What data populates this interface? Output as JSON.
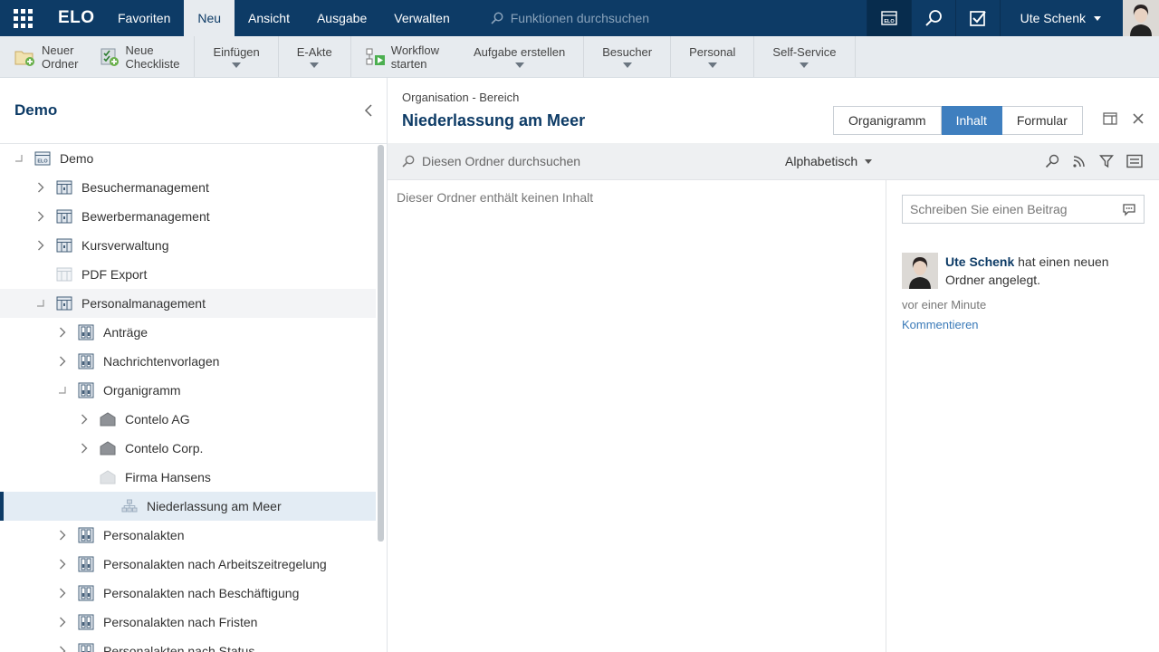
{
  "topbar": {
    "logo": "ELO",
    "menu": [
      "Favoriten",
      "Neu",
      "Ansicht",
      "Ausgabe",
      "Verwalten"
    ],
    "active_menu": "Neu",
    "search_placeholder": "Funktionen durchsuchen",
    "user_name": "Ute Schenk",
    "brand_color": "#0d3b66"
  },
  "ribbon": {
    "new_folder": [
      "Neuer",
      "Ordner"
    ],
    "new_checklist": [
      "Neue",
      "Checkliste"
    ],
    "insert": "Einfügen",
    "e_akte": "E-Akte",
    "workflow": [
      "Workflow",
      "starten"
    ],
    "create_task": "Aufgabe erstellen",
    "visitor": "Besucher",
    "personnel": "Personal",
    "self_service": "Self-Service"
  },
  "left_panel": {
    "title": "Demo",
    "tree": [
      {
        "label": "Demo",
        "level": 0,
        "state": "open",
        "icon": "elo-archive-icon"
      },
      {
        "label": "Besuchermanagement",
        "level": 1,
        "state": "closed",
        "icon": "cabinet-icon"
      },
      {
        "label": "Bewerbermanagement",
        "level": 1,
        "state": "closed",
        "icon": "cabinet-icon"
      },
      {
        "label": "Kursverwaltung",
        "level": 1,
        "state": "closed",
        "icon": "cabinet-icon"
      },
      {
        "label": "PDF Export",
        "level": 1,
        "state": "none",
        "icon": "cabinet-light-icon"
      },
      {
        "label": "Personalmanagement",
        "level": 1,
        "state": "open",
        "icon": "cabinet-icon"
      },
      {
        "label": "Anträge",
        "level": 2,
        "state": "closed",
        "icon": "binder-icon"
      },
      {
        "label": "Nachrichtenvorlagen",
        "level": 2,
        "state": "closed",
        "icon": "binder-icon"
      },
      {
        "label": "Organigramm",
        "level": 2,
        "state": "open",
        "icon": "binder-icon"
      },
      {
        "label": "Contelo AG",
        "level": 3,
        "state": "closed",
        "icon": "building-icon"
      },
      {
        "label": "Contelo Corp.",
        "level": 3,
        "state": "closed",
        "icon": "building-icon"
      },
      {
        "label": "Firma Hansens",
        "level": 3,
        "state": "none",
        "icon": "building-light-icon"
      },
      {
        "label": "Niederlassung am Meer",
        "level": 4,
        "state": "none",
        "icon": "org-chart-icon",
        "selected": true
      },
      {
        "label": "Personalakten",
        "level": 2,
        "state": "closed",
        "icon": "binder-icon"
      },
      {
        "label": "Personalakten nach Arbeitszeitregelung",
        "level": 2,
        "state": "closed",
        "icon": "binder-icon"
      },
      {
        "label": "Personalakten nach Beschäftigung",
        "level": 2,
        "state": "closed",
        "icon": "binder-icon"
      },
      {
        "label": "Personalakten nach Fristen",
        "level": 2,
        "state": "closed",
        "icon": "binder-icon"
      },
      {
        "label": "Personalakten nach Status",
        "level": 2,
        "state": "closed",
        "icon": "binder-icon"
      }
    ]
  },
  "main": {
    "breadcrumb": "Organisation - Bereich",
    "title": "Niederlassung am Meer",
    "tabs": [
      "Organigramm",
      "Inhalt",
      "Formular"
    ],
    "active_tab": "Inhalt",
    "search_placeholder": "Diesen Ordner durchsuchen",
    "sort": "Alphabetisch",
    "empty_message": "Dieser Ordner enthält keinen Inhalt"
  },
  "feed": {
    "post_placeholder": "Schreiben Sie einen Beitrag",
    "user": "Ute Schenk",
    "message": "hat einen neuen Ordner angelegt.",
    "time": "vor einer Minute",
    "comment_link": "Kommentieren"
  }
}
